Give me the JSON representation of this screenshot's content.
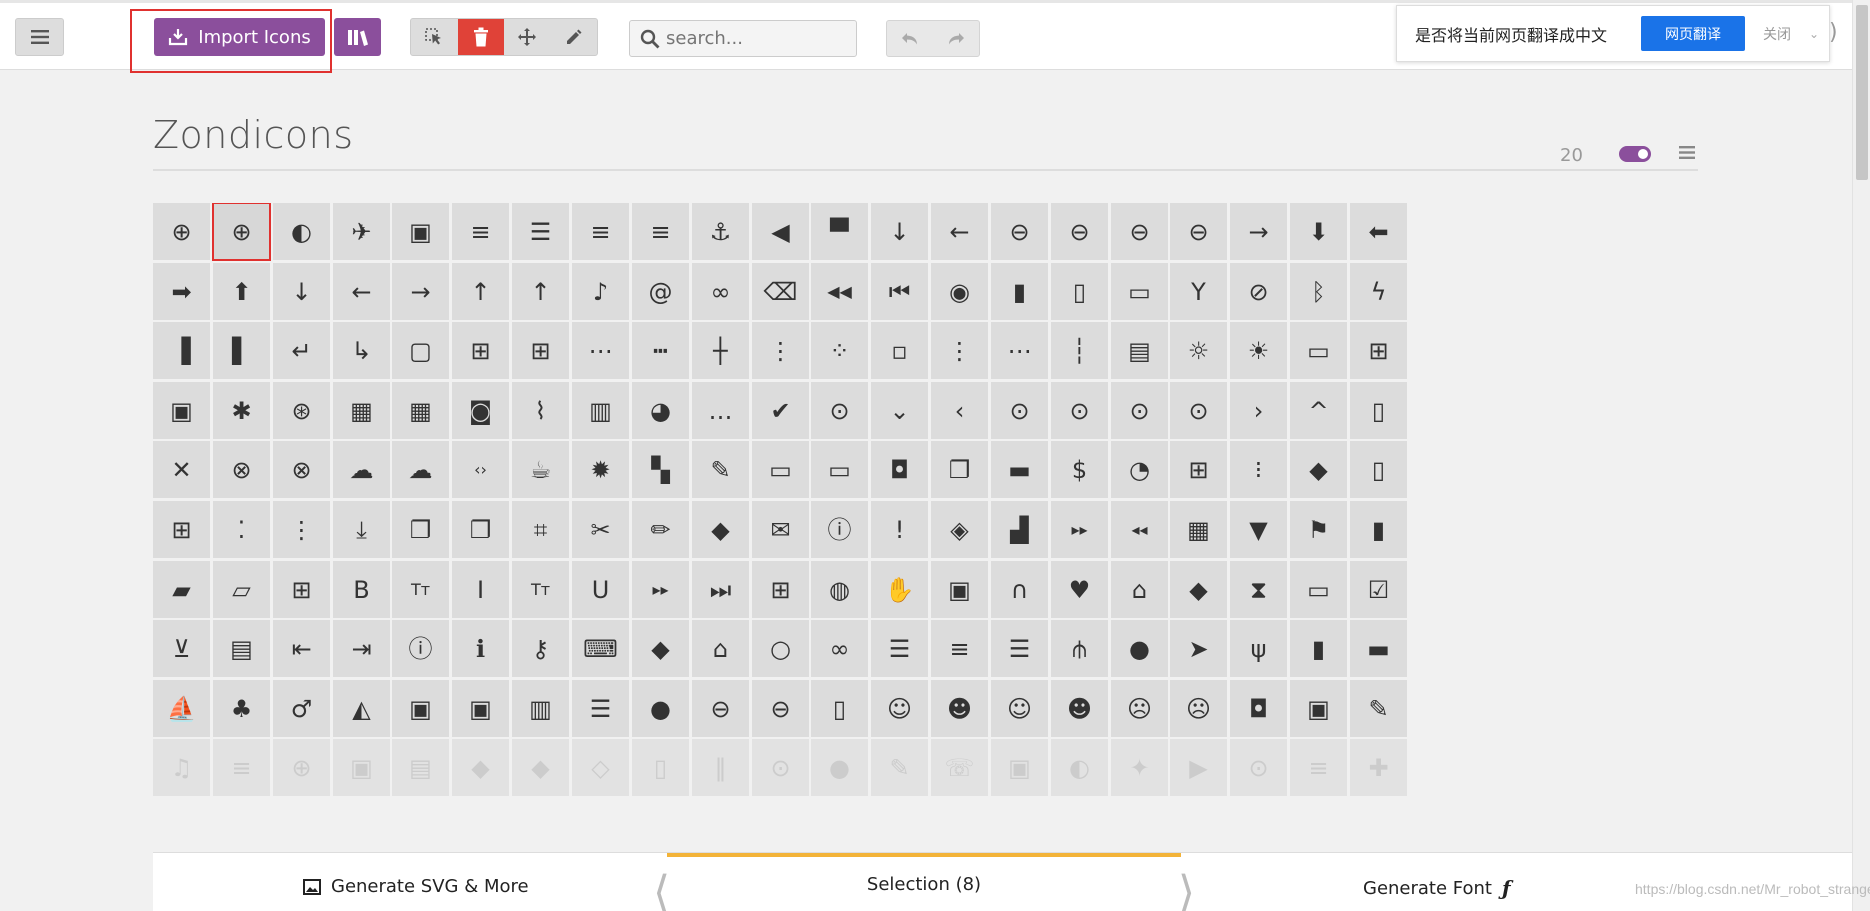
{
  "toolbar": {
    "import_label": "Import Icons",
    "search_placeholder": "search..."
  },
  "translate": {
    "prompt": "是否将当前网页翻译成中文",
    "translate_button": "网页翻译",
    "close_label": "关闭"
  },
  "set": {
    "title": "Zondicons",
    "icon_count": "20"
  },
  "footer": {
    "generate_svg_label": "Generate SVG & More",
    "selection_label": "Selection (8)",
    "generate_font_label": "Generate Font"
  },
  "watermark": "https://blog.csdn.net/Mr_robot_strange",
  "colors": {
    "accent": "#8b4f9c",
    "danger": "#e04238",
    "highlight": "#e0312f",
    "selection_bar": "#f3b338",
    "translate_button": "#1a73e8"
  },
  "grid": {
    "selected": "add-solid-icon",
    "rows": [
      [
        "add-outline-icon",
        "add-solid-icon",
        "adjust-icon",
        "airplane-icon",
        "album-icon",
        "align-center-icon",
        "align-justified-icon",
        "align-left-icon",
        "align-right-icon",
        "anchor-icon",
        "announcement-icon",
        "apparel-icon",
        "arrow-down-icon",
        "arrow-left-icon",
        "arrow-outline-down-icon",
        "arrow-outline-left-icon",
        "arrow-outline-right-icon",
        "arrow-outline-up-icon",
        "arrow-right-icon",
        "arrow-thick-down-icon",
        "arrow-thick-left-icon"
      ],
      [
        "arrow-thick-right-icon",
        "arrow-thick-up-icon",
        "arrow-thin-down-icon",
        "arrow-thin-left-icon",
        "arrow-thin-right-icon",
        "arrow-thin-up-icon",
        "arrow-up-icon",
        "artist-icon",
        "at-symbol-icon",
        "attachment-icon",
        "backspace-icon",
        "backward-icon",
        "backward-step-icon",
        "badge-icon",
        "battery-full-icon",
        "battery-half-icon",
        "battery-low-icon",
        "beverage-icon",
        "block-icon",
        "bluetooth-icon",
        "bolt-icon"
      ],
      [
        "book-reference-icon",
        "bookmark-icon",
        "arrow-return-icon",
        "arrow-corner-icon",
        "bookmark-outline-icon",
        "bookmark-outline-add-icon",
        "border-all-icon",
        "border-bottom-icon",
        "border-horizontal-icon",
        "border-inner-icon",
        "border-left-icon",
        "border-none-icon",
        "border-outer-icon",
        "border-right-icon",
        "border-top-icon",
        "border-vertical-icon",
        "box-icon",
        "brightness-down-icon",
        "brightness-up-icon",
        "browser-window-icon",
        "browser-window-new-icon"
      ],
      [
        "browser-window-open-icon",
        "bug-icon",
        "buoy-icon",
        "calculator-icon",
        "calendar-icon",
        "camera-icon",
        "chart-icon",
        "chart-bar-icon",
        "chart-pie-icon",
        "chat-bubble-dots-icon",
        "checkmark-icon",
        "checkmark-outline-icon",
        "cheveron-down-icon",
        "cheveron-left-icon",
        "cheveron-outline-down-icon",
        "cheveron-outline-left-icon",
        "cheveron-outline-right-icon",
        "cheveron-outline-up-icon",
        "cheveron-right-icon",
        "cheveron-up-icon",
        "clipboard-icon"
      ],
      [
        "close-icon",
        "close-outline-icon",
        "close-solid-icon",
        "cloud-icon",
        "cloud-upload-icon",
        "code-icon",
        "coffee-icon",
        "cog-icon",
        "color-palette-icon",
        "compose-icon",
        "computer-desktop-icon",
        "computer-laptop-icon",
        "conversation-icon",
        "copy-icon",
        "credit-card-icon",
        "currency-dollar-icon",
        "dashboard-icon",
        "date-add-icon",
        "dial-pad-icon",
        "directions-icon",
        "document-icon"
      ],
      [
        "document-add-icon",
        "dots-horizontal-double-icon",
        "dots-vertical-icon",
        "download-icon",
        "duplicate-icon",
        "duplicate-outline-icon",
        "crop-icon",
        "scissors-icon",
        "edit-pencil-icon",
        "education-icon",
        "envelope-icon",
        "exclamation-outline-icon",
        "exclamation-solid-icon",
        "explore-icon",
        "factory-icon",
        "fast-forward-icon",
        "fast-rewind-icon",
        "film-icon",
        "filter-icon",
        "flag-icon",
        "flashlight-icon"
      ],
      [
        "folder-icon",
        "folder-outline-icon",
        "folder-outline-add-icon",
        "format-bold-icon",
        "format-font-size-icon",
        "format-italic-icon",
        "format-text-size-icon",
        "format-underline-icon",
        "forward-icon",
        "forward-step-icon",
        "gift-icon",
        "globe-icon",
        "hand-stop-icon",
        "hard-drive-icon",
        "headphones-icon",
        "heart-icon",
        "home-icon",
        "hot-icon",
        "hour-glass-icon",
        "inbox-icon",
        "inbox-check-icon"
      ],
      [
        "inbox-download-icon",
        "inbox-full-icon",
        "indent-decrease-icon",
        "indent-increase-icon",
        "information-outline-icon",
        "information-solid-icon",
        "key-icon",
        "keyboard-icon",
        "layers-icon",
        "library-icon",
        "light-bulb-icon",
        "link-icon",
        "list-icon",
        "list-add-icon",
        "list-bullet-icon",
        "load-balancer-icon",
        "location-icon",
        "location-current-icon",
        "location-food-icon",
        "location-gas-station-icon",
        "location-hotel-icon"
      ],
      [
        "location-marina-icon",
        "location-park-icon",
        "location-restroom-icon",
        "location-shopping-icon",
        "lock-closed-icon",
        "lock-open-icon",
        "map-icon",
        "menu-icon",
        "mic-icon",
        "minus-outline-icon",
        "minus-solid-icon",
        "mobile-devices-icon",
        "mood-happy-outline-icon",
        "mood-happy-solid-icon",
        "mood-neutral-outline-icon",
        "mood-neutral-solid-icon",
        "mood-sad-outline-icon",
        "mood-sad-solid-icon",
        "mouse-icon",
        "music-album-icon",
        "music-artist-icon"
      ],
      [
        "music-notes-icon",
        "music-playlist-icon",
        "navigation-more-icon",
        "network-icon",
        "news-paper-icon",
        "notification-icon",
        "notifications-icon",
        "notifications-outline-icon",
        "paste-icon",
        "pause-icon",
        "pause-outline-icon",
        "pause-solid-icon",
        "pen-tool-icon",
        "phone-icon",
        "photo-icon",
        "php-elephant-icon",
        "pin-icon",
        "play-icon",
        "play-outline-icon",
        "playlist-icon",
        "plugin-icon"
      ]
    ]
  }
}
